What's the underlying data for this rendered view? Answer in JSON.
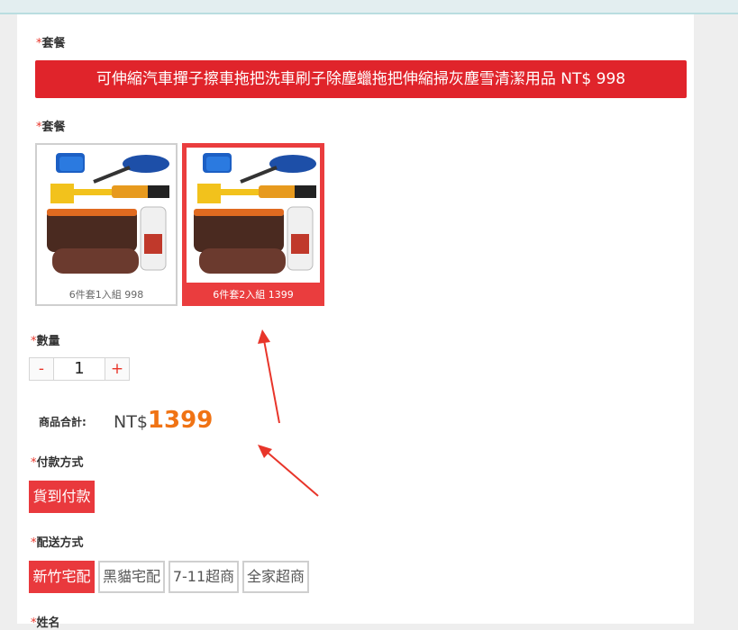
{
  "package_label": "套餐",
  "required_mark": "*",
  "banner_text": "可伸縮汽車撣子擦車拖把洗車刷子除塵蠟拖把伸縮掃灰塵雪清潔用品 NT$ 998",
  "package_options": [
    {
      "caption": "6件套1入組 998",
      "selected": false
    },
    {
      "caption": "6件套2入組 1399",
      "selected": true
    }
  ],
  "quantity": {
    "label": "數量",
    "minus": "-",
    "value": "1",
    "plus": "+"
  },
  "subtotal": {
    "label": "商品合計:",
    "currency": "NT$",
    "amount": "1399"
  },
  "payment": {
    "label": "付款方式",
    "options": [
      "貨到付款"
    ]
  },
  "delivery": {
    "label": "配送方式",
    "options": [
      "新竹宅配",
      "黑貓宅配",
      "7-11超商",
      "全家超商"
    ],
    "selected_index": 0
  },
  "name_label": "姓名",
  "colors": {
    "accent": "#e0242b",
    "price": "#f07314",
    "star": "#e8352a"
  }
}
